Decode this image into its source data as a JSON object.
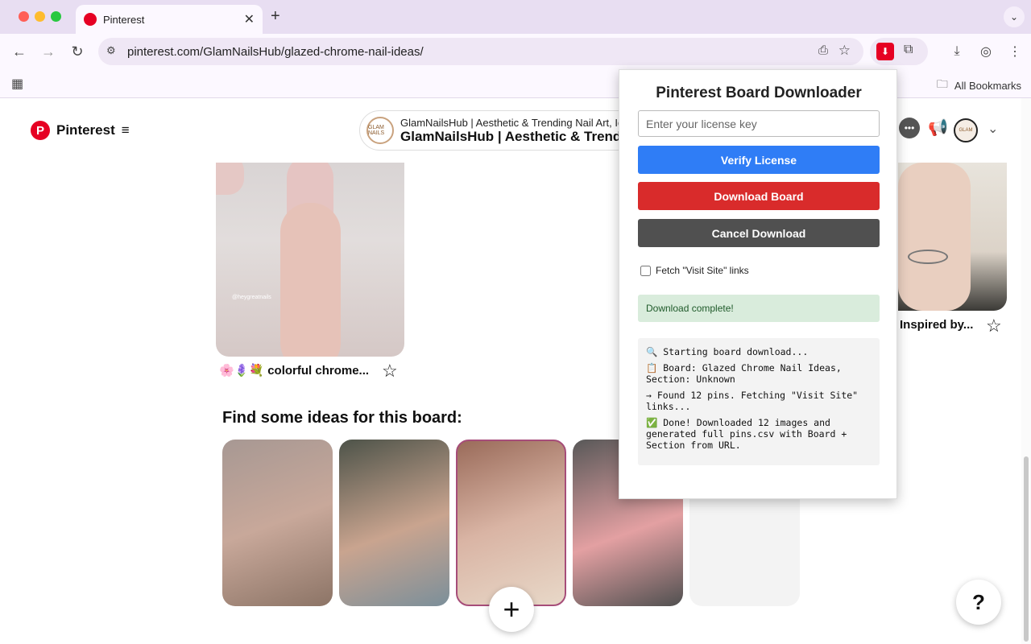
{
  "browser": {
    "tab_title": "Pinterest",
    "tab_close": "✕",
    "new_tab": "+",
    "url": "pinterest.com/GlamNailsHub/glazed-chrome-nail-ideas/",
    "all_bookmarks": "All Bookmarks"
  },
  "pinterest": {
    "logo_text": "Pinterest",
    "board_subtitle": "GlamNailsHub | Aesthetic & Trending Nail Art, Ide",
    "board_title": "GlamNailsHub | Aesthetic & Trending",
    "avatar_text": "GLAM NAILS",
    "pin1_caption": "🌸🪻💐 colorful chrome...",
    "pin2_caption": "Inspired by...",
    "watermark": "@heygreatnails",
    "section_title": "Find some ideas for this board:",
    "plus_label": "+",
    "help_label": "?"
  },
  "popup": {
    "title": "Pinterest Board Downloader",
    "license_placeholder": "Enter your license key",
    "license_value": "",
    "verify_label": "Verify License",
    "download_label": "Download Board",
    "cancel_label": "Cancel Download",
    "fetch_label": "Fetch \"Visit Site\" links",
    "fetch_checked": false,
    "status": "Download complete!",
    "log": [
      "🔍 Starting board download...",
      "📋 Board: Glazed Chrome Nail Ideas, Section: Unknown",
      "→ Found 12 pins. Fetching \"Visit Site\" links...",
      "✅ Done! Downloaded 12 images and generated full pins.csv with Board + Section from URL."
    ]
  },
  "colors": {
    "verify": "#2f7df6",
    "download": "#d92b2b",
    "cancel": "#505050",
    "pinterest_red": "#e60023"
  }
}
